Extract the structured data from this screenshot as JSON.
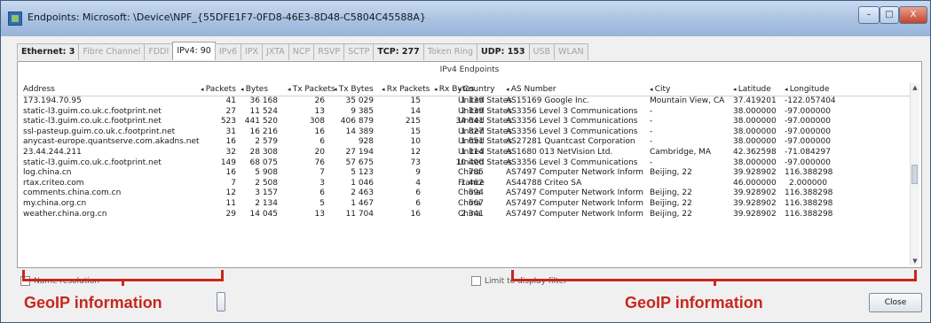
{
  "window": {
    "title": "Endpoints: Microsoft: \\Device\\NPF_{55DFE1F7-0FD8-46E3-8D48-C5804C45588A}",
    "controls": [
      "–",
      "□",
      "X"
    ]
  },
  "tabs": [
    {
      "label": "Ethernet: 3",
      "state": "bold"
    },
    {
      "label": "Fibre Channel",
      "state": "disabled"
    },
    {
      "label": "FDDI",
      "state": "disabled"
    },
    {
      "label": "IPv4: 90",
      "state": "active"
    },
    {
      "label": "IPv6",
      "state": "disabled"
    },
    {
      "label": "IPX",
      "state": "disabled"
    },
    {
      "label": "JXTA",
      "state": "disabled"
    },
    {
      "label": "NCP",
      "state": "disabled"
    },
    {
      "label": "RSVP",
      "state": "disabled"
    },
    {
      "label": "SCTP",
      "state": "disabled"
    },
    {
      "label": "TCP: 277",
      "state": "bold"
    },
    {
      "label": "Token Ring",
      "state": "disabled"
    },
    {
      "label": "UDP: 153",
      "state": "bold"
    },
    {
      "label": "USB",
      "state": "disabled"
    },
    {
      "label": "WLAN",
      "state": "disabled"
    }
  ],
  "panel_title": "IPv4 Endpoints",
  "columns": [
    "Address",
    "Packets",
    "Bytes",
    "Tx Packets",
    "Tx Bytes",
    "Rx Packets",
    "Rx Bytes",
    "Country",
    "AS Number",
    "City",
    "Latitude",
    "Longitude"
  ],
  "rows": [
    [
      "173.194.70.95",
      "41",
      "36 168",
      "26",
      "35 029",
      "15",
      "1 139",
      "United States",
      "AS15169 Google Inc.",
      "Mountain View, CA",
      "37.419201",
      "-122.057404"
    ],
    [
      "static-l3.guim.co.uk.c.footprint.net",
      "27",
      "11 524",
      "13",
      "9 385",
      "14",
      "2 139",
      "United States",
      "AS3356 Level 3 Communications",
      "-",
      "38.000000",
      "-97.000000"
    ],
    [
      "static-l3.guim.co.uk.c.footprint.net",
      "523",
      "441 520",
      "308",
      "406 879",
      "215",
      "34 641",
      "United States",
      "AS3356 Level 3 Communications",
      "-",
      "38.000000",
      "-97.000000"
    ],
    [
      "ssl-pasteup.guim.co.uk.c.footprint.net",
      "31",
      "16 216",
      "16",
      "14 389",
      "15",
      "1 827",
      "United States",
      "AS3356 Level 3 Communications",
      "-",
      "38.000000",
      "-97.000000"
    ],
    [
      "anycast-europe.quantserve.com.akadns.net",
      "16",
      "2 579",
      "6",
      "928",
      "10",
      "1 651",
      "United States",
      "AS27281 Quantcast Corporation",
      "-",
      "38.000000",
      "-97.000000"
    ],
    [
      "23.44.244.211",
      "32",
      "28 308",
      "20",
      "27 194",
      "12",
      "1 114",
      "United States",
      "AS1680 013 NetVision Ltd.",
      "Cambridge, MA",
      "42.362598",
      "-71.084297"
    ],
    [
      "static-l3.guim.co.uk.c.footprint.net",
      "149",
      "68 075",
      "76",
      "57 675",
      "73",
      "10 400",
      "United States",
      "AS3356 Level 3 Communications",
      "-",
      "38.000000",
      "-97.000000"
    ],
    [
      "log.china.cn",
      "16",
      "5 908",
      "7",
      "5 123",
      "9",
      "785",
      "China",
      "AS7497 Computer Network Inform",
      "Beijing, 22",
      "39.928902",
      "116.388298"
    ],
    [
      "rtax.criteo.com",
      "7",
      "2 508",
      "3",
      "1 046",
      "4",
      "1 462",
      "France",
      "AS44788 Criteo SA",
      "",
      "46.000000",
      "2.000000"
    ],
    [
      "comments.china.com.cn",
      "12",
      "3 157",
      "6",
      "2 463",
      "6",
      "694",
      "China",
      "AS7497 Computer Network Inform",
      "Beijing, 22",
      "39.928902",
      "116.388298"
    ],
    [
      "my.china.org.cn",
      "11",
      "2 134",
      "5",
      "1 467",
      "6",
      "667",
      "China",
      "AS7497 Computer Network Inform",
      "Beijing, 22",
      "39.928902",
      "116.388298"
    ],
    [
      "weather.china.org.cn",
      "29",
      "14 045",
      "13",
      "11 704",
      "16",
      "2 341",
      "China",
      "AS7497 Computer Network Inform",
      "Beijing, 22",
      "39.928902",
      "116.388298"
    ]
  ],
  "name_resolution": "Name resolution",
  "limit_filter": "Limit to display filter",
  "close_button": "Close",
  "annotation_left": "GeoIP information",
  "annotation_right": "GeoIP information",
  "colors": {
    "annotation": "#c8271d",
    "titlebar": "#a9c2e2"
  }
}
